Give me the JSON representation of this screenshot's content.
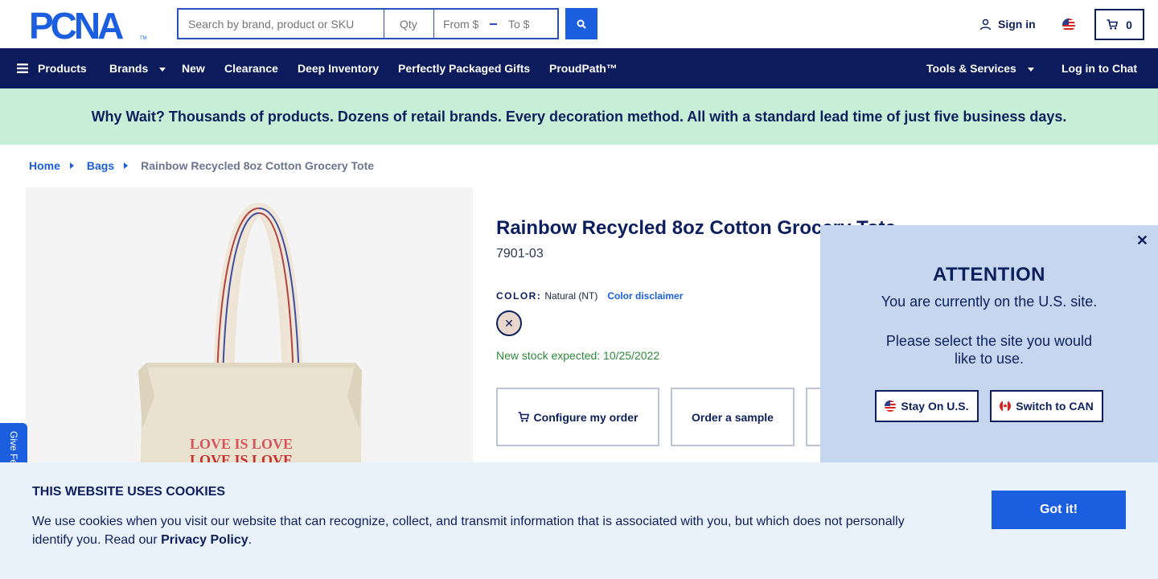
{
  "header": {
    "logo_text": "PCNA",
    "search_placeholder": "Search by brand, product or SKU",
    "qty_placeholder": "Qty",
    "price_from_placeholder": "From $",
    "price_to_placeholder": "To $",
    "sign_in": "Sign in",
    "cart_count": "0"
  },
  "nav": {
    "products": "Products",
    "brands": "Brands",
    "new": "New",
    "clearance": "Clearance",
    "deep_inventory": "Deep Inventory",
    "gifts": "Perfectly Packaged Gifts",
    "proudpath": "ProudPath™",
    "tools": "Tools & Services",
    "chat": "Log in to Chat"
  },
  "promo": "Why Wait? Thousands of products. Dozens of retail brands. Every decoration method. All with a standard lead time of just five business days.",
  "breadcrumb": {
    "home": "Home",
    "bags": "Bags",
    "current": "Rainbow Recycled 8oz Cotton Grocery Tote"
  },
  "product": {
    "title": "Rainbow Recycled 8oz Cotton Grocery Tote",
    "sku": "7901-03",
    "color_label": "COLOR:",
    "color_value": "Natural (NT)",
    "color_disclaimer": "Color disclaimer",
    "stock": "New stock expected: 10/25/2022",
    "configure": "Configure my order",
    "sample": "Order a sample",
    "print_text_1": "LOVE IS LOVE",
    "print_text_2": "LOVE IS LOVE"
  },
  "attention": {
    "title": "ATTENTION",
    "line1": "You are currently on the U.S. site.",
    "line2": "Please select the site you would like to use.",
    "stay": "Stay On U.S.",
    "switch": "Switch to CAN"
  },
  "feedback": "Give Feedback",
  "cookies": {
    "title": "THIS WEBSITE USES COOKIES",
    "text": "We use cookies when you visit our website that can recognize, collect, and transmit information that is associated with you, but which does not personally identify you. Read our",
    "privacy": "Privacy Policy",
    "period": ".",
    "button": "Got it!"
  },
  "colors": {
    "navy": "#0b1b5c",
    "blue": "#1b5fe0",
    "promo_green": "#c7efd7",
    "popup_blue": "#c7d6ef",
    "stock_green": "#2e8a3a"
  }
}
